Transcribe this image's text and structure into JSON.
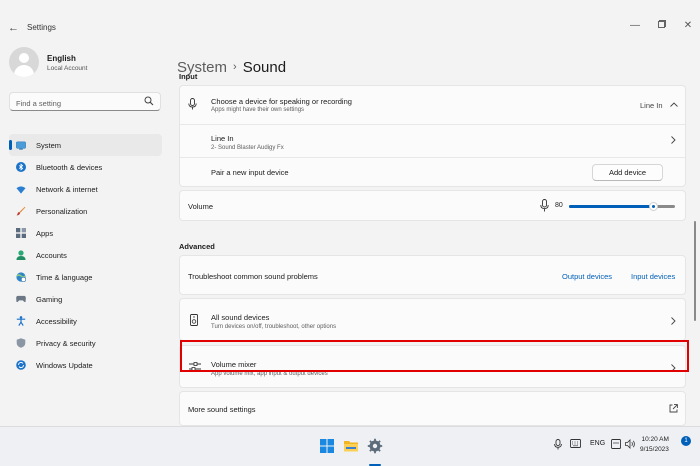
{
  "window": {
    "title": "Settings"
  },
  "profile": {
    "name": "English",
    "account_type": "Local Account"
  },
  "search": {
    "placeholder": "Find a setting"
  },
  "sidebar": {
    "items": [
      {
        "label": "System",
        "icon": "monitor-icon",
        "active": true
      },
      {
        "label": "Bluetooth & devices",
        "icon": "bluetooth-icon"
      },
      {
        "label": "Network & internet",
        "icon": "wifi-icon"
      },
      {
        "label": "Personalization",
        "icon": "brush-icon"
      },
      {
        "label": "Apps",
        "icon": "apps-icon"
      },
      {
        "label": "Accounts",
        "icon": "person-icon"
      },
      {
        "label": "Time & language",
        "icon": "globe-clock-icon"
      },
      {
        "label": "Gaming",
        "icon": "gamepad-icon"
      },
      {
        "label": "Accessibility",
        "icon": "accessibility-icon"
      },
      {
        "label": "Privacy & security",
        "icon": "shield-icon"
      },
      {
        "label": "Windows Update",
        "icon": "update-icon"
      }
    ]
  },
  "breadcrumb": {
    "parent": "System",
    "separator": "›",
    "current": "Sound"
  },
  "input": {
    "section_label": "Input",
    "choose_device": {
      "title": "Choose a device for speaking or recording",
      "subtitle": "Apps might have their own settings",
      "value": "Line In"
    },
    "line_in": {
      "title": "Line In",
      "subtitle": "2- Sound Blaster Audigy Fx"
    },
    "pair": {
      "title": "Pair a new input device",
      "button": "Add device"
    },
    "volume": {
      "label": "Volume",
      "value": "80",
      "level": 80,
      "max": 100
    }
  },
  "advanced": {
    "section_label": "Advanced",
    "troubleshoot": {
      "title": "Troubleshoot common sound problems",
      "link_output": "Output devices",
      "link_input": "Input devices"
    },
    "all_devices": {
      "title": "All sound devices",
      "subtitle": "Turn devices on/off, troubleshoot, other options"
    },
    "volume_mixer": {
      "title": "Volume mixer",
      "subtitle": "App volume mix, app input & output devices"
    },
    "more_settings": {
      "title": "More sound settings"
    }
  },
  "taskbar": {
    "language": "ENG",
    "time": "10:20 AM",
    "date": "9/15/2023",
    "notification_count": "1"
  },
  "colors": {
    "accent": "#005fb8",
    "highlight_box": "#e00000"
  }
}
